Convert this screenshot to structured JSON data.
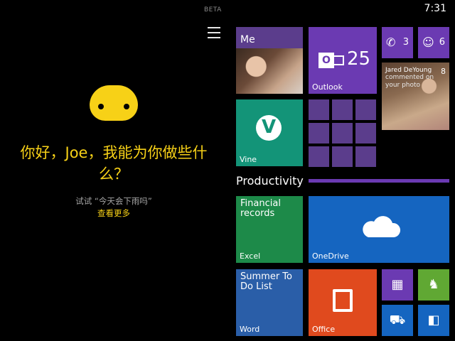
{
  "cortana": {
    "beta_label": "BETA",
    "greeting": "你好，Joe，我能为你做些什么？",
    "try_hint": "试试 “今天会下雨吗”",
    "see_more": "查看更多",
    "accent_color": "#f7d117"
  },
  "status_bar": {
    "time": "7:31"
  },
  "start": {
    "me": {
      "label": "Me"
    },
    "outlook": {
      "label": "Outlook",
      "count": "25",
      "icon_letter": "O"
    },
    "phone": {
      "count": "3"
    },
    "messaging": {
      "count": "6"
    },
    "people": {
      "name": "Jared DeYoung",
      "text": "commented on your photo",
      "count": "8"
    },
    "vine": {
      "label": "Vine",
      "logo": "V"
    },
    "group_title": "Productivity",
    "excel": {
      "title": "Financial records",
      "label": "Excel"
    },
    "onedrive": {
      "label": "OneDrive"
    },
    "word": {
      "title": "Summer To Do List",
      "label": "Word"
    },
    "office": {
      "label": "Office"
    }
  },
  "icons": [
    "menu-icon",
    "cortana-face-icon",
    "phone-icon",
    "messaging-icon",
    "people-icon",
    "outlook-icon",
    "vine-icon",
    "cloud-icon",
    "office-icon",
    "calculator-icon",
    "evernote-icon",
    "car-icon",
    "lync-icon"
  ]
}
